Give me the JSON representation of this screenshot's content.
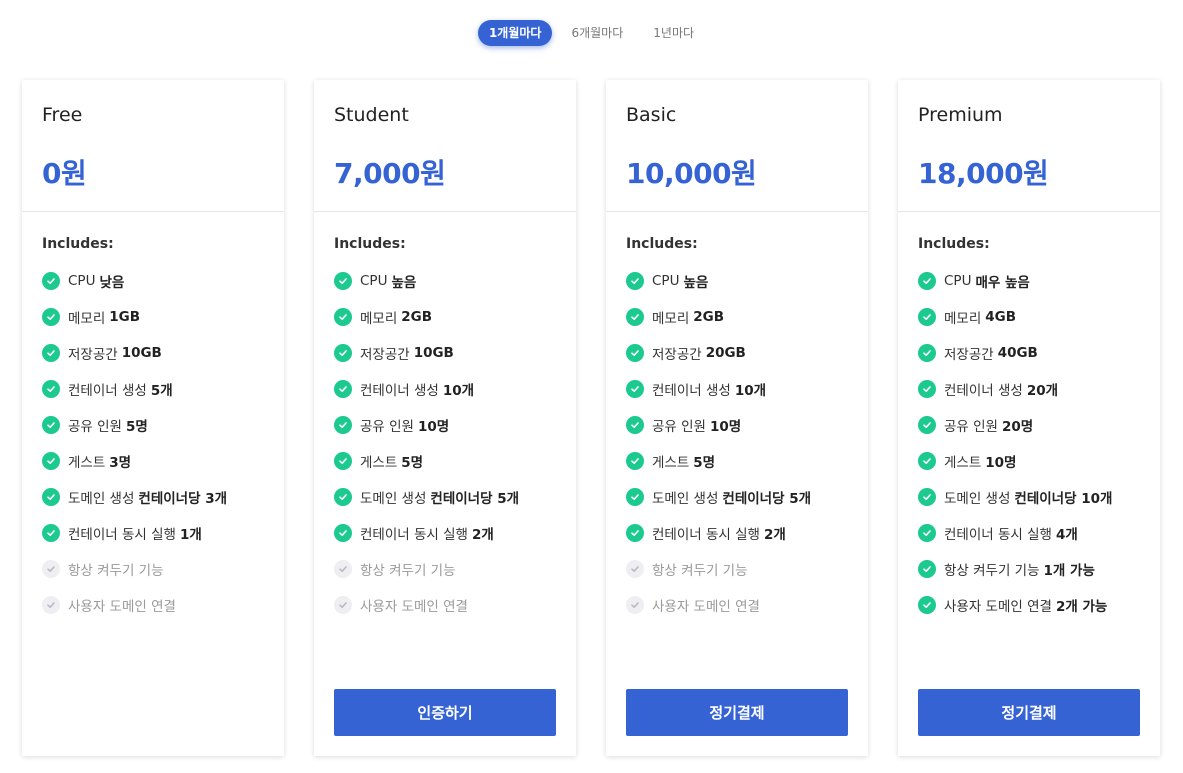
{
  "period_toggle": {
    "options": [
      "1개월마다",
      "6개월마다",
      "1년마다"
    ],
    "selected": "1개월마다"
  },
  "colors": {
    "accent": "#3563d4",
    "check": "#1cc98f",
    "disabled_check": "#eeeef3"
  },
  "includes_label": "Includes:",
  "plans": [
    {
      "name": "Free",
      "price": "0원",
      "cta": null,
      "features": [
        {
          "label": "CPU",
          "value": "낮음",
          "enabled": true
        },
        {
          "label": "메모리",
          "value": "1GB",
          "enabled": true
        },
        {
          "label": "저장공간",
          "value": "10GB",
          "enabled": true
        },
        {
          "label": "컨테이너 생성",
          "value": "5개",
          "enabled": true
        },
        {
          "label": "공유 인원",
          "value": "5명",
          "enabled": true
        },
        {
          "label": "게스트",
          "value": "3명",
          "enabled": true
        },
        {
          "label": "도메인 생성",
          "value": "컨테이너당 3개",
          "enabled": true
        },
        {
          "label": "컨테이너 동시 실행",
          "value": "1개",
          "enabled": true
        },
        {
          "label": "항상 켜두기 기능",
          "value": "",
          "enabled": false
        },
        {
          "label": "사용자 도메인 연결",
          "value": "",
          "enabled": false
        }
      ]
    },
    {
      "name": "Student",
      "price": "7,000원",
      "cta": "인증하기",
      "features": [
        {
          "label": "CPU",
          "value": "높음",
          "enabled": true
        },
        {
          "label": "메모리",
          "value": "2GB",
          "enabled": true
        },
        {
          "label": "저장공간",
          "value": "10GB",
          "enabled": true
        },
        {
          "label": "컨테이너 생성",
          "value": "10개",
          "enabled": true
        },
        {
          "label": "공유 인원",
          "value": "10명",
          "enabled": true
        },
        {
          "label": "게스트",
          "value": "5명",
          "enabled": true
        },
        {
          "label": "도메인 생성",
          "value": "컨테이너당 5개",
          "enabled": true
        },
        {
          "label": "컨테이너 동시 실행",
          "value": "2개",
          "enabled": true
        },
        {
          "label": "항상 켜두기 기능",
          "value": "",
          "enabled": false
        },
        {
          "label": "사용자 도메인 연결",
          "value": "",
          "enabled": false
        }
      ]
    },
    {
      "name": "Basic",
      "price": "10,000원",
      "cta": "정기결제",
      "features": [
        {
          "label": "CPU",
          "value": "높음",
          "enabled": true
        },
        {
          "label": "메모리",
          "value": "2GB",
          "enabled": true
        },
        {
          "label": "저장공간",
          "value": "20GB",
          "enabled": true
        },
        {
          "label": "컨테이너 생성",
          "value": "10개",
          "enabled": true
        },
        {
          "label": "공유 인원",
          "value": "10명",
          "enabled": true
        },
        {
          "label": "게스트",
          "value": "5명",
          "enabled": true
        },
        {
          "label": "도메인 생성",
          "value": "컨테이너당 5개",
          "enabled": true
        },
        {
          "label": "컨테이너 동시 실행",
          "value": "2개",
          "enabled": true
        },
        {
          "label": "항상 켜두기 기능",
          "value": "",
          "enabled": false
        },
        {
          "label": "사용자 도메인 연결",
          "value": "",
          "enabled": false
        }
      ]
    },
    {
      "name": "Premium",
      "price": "18,000원",
      "cta": "정기결제",
      "features": [
        {
          "label": "CPU",
          "value": "매우 높음",
          "enabled": true
        },
        {
          "label": "메모리",
          "value": "4GB",
          "enabled": true
        },
        {
          "label": "저장공간",
          "value": "40GB",
          "enabled": true
        },
        {
          "label": "컨테이너 생성",
          "value": "20개",
          "enabled": true
        },
        {
          "label": "공유 인원",
          "value": "20명",
          "enabled": true
        },
        {
          "label": "게스트",
          "value": "10명",
          "enabled": true
        },
        {
          "label": "도메인 생성",
          "value": "컨테이너당 10개",
          "enabled": true
        },
        {
          "label": "컨테이너 동시 실행",
          "value": "4개",
          "enabled": true
        },
        {
          "label": "항상 켜두기 기능",
          "value": "1개 가능",
          "enabled": true
        },
        {
          "label": "사용자 도메인 연결",
          "value": "2개 가능",
          "enabled": true
        }
      ]
    }
  ]
}
